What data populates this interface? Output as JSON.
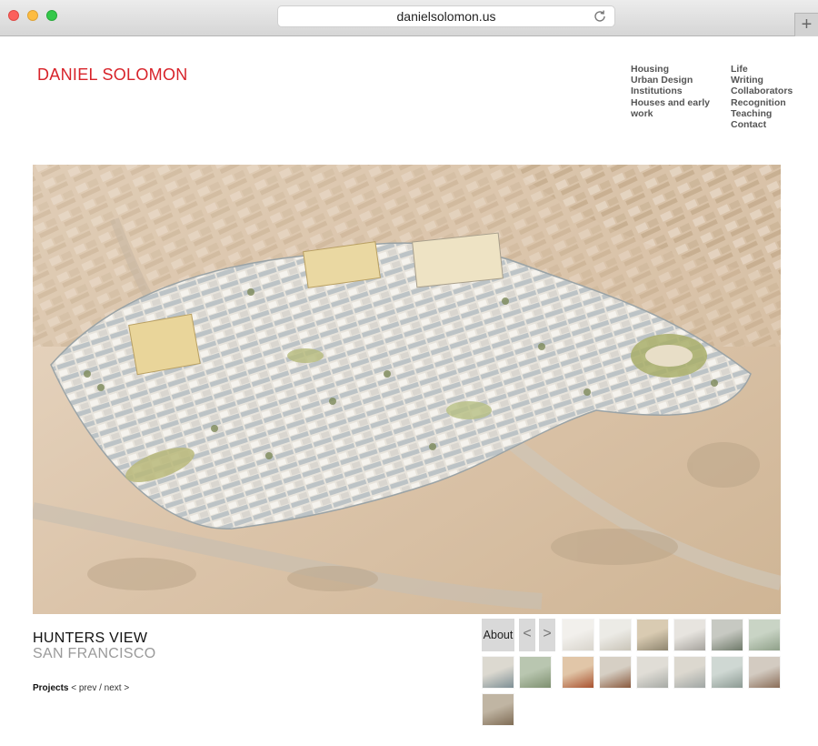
{
  "browser": {
    "url": "danielsolomon.us",
    "new_tab_symbol": "+"
  },
  "site": {
    "name": "DANIEL SOLOMON",
    "accent": "#d8232a"
  },
  "nav": {
    "col1": [
      "Housing",
      "Urban Design",
      "Institutions",
      "Houses and early work"
    ],
    "col2": [
      "Life",
      "Writing",
      "Collaborators",
      "Recognition",
      "Teaching",
      "Contact"
    ]
  },
  "project": {
    "title": "HUNTERS VIEW",
    "location": "SAN FRANCISCO"
  },
  "pager": {
    "projects": "Projects",
    "prev": "< prev",
    "sep": "/",
    "next": "next >"
  },
  "gallery": {
    "about": "About",
    "prev": "<",
    "next": ">",
    "thumbnail_count": 14
  }
}
